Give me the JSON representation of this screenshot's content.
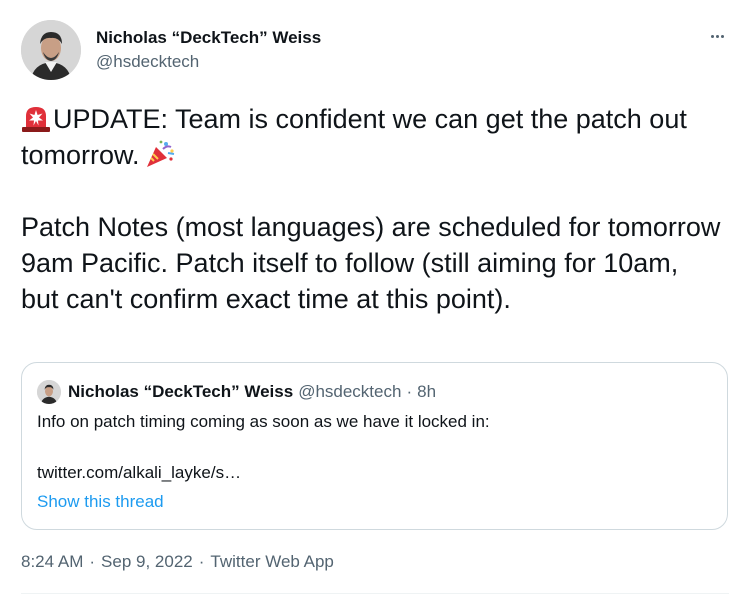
{
  "author": {
    "display_name": "Nicholas “DeckTech” Weiss",
    "handle": "@hsdecktech"
  },
  "more_menu_icon": "three-dots-horizontal",
  "tweet": {
    "line1_text": "UPDATE: Team is confident we can get the patch out tomorrow.",
    "line1_emoji_start": "rotating-light-emoji",
    "line1_emoji_end": "party-popper-emoji",
    "paragraph2": "Patch Notes (most languages) are scheduled for tomorrow 9am Pacific. Patch itself to follow (still aiming for 10am, but can't confirm exact time at this point)."
  },
  "quote": {
    "display_name": "Nicholas “DeckTech” Weiss",
    "handle": "@hsdecktech",
    "separator": "·",
    "time": "8h",
    "text": "Info on patch timing coming as soon as we have it locked in:",
    "link": "twitter.com/alkali_layke/s…",
    "show_thread": "Show this thread"
  },
  "meta": {
    "time": "8:24 AM",
    "sep1": "·",
    "date": "Sep 9, 2022",
    "sep2": "·",
    "source": "Twitter Web App"
  },
  "colors": {
    "text": "#0f1419",
    "secondary": "#536471",
    "link": "#1d9bf0",
    "border": "#cfd9de"
  }
}
